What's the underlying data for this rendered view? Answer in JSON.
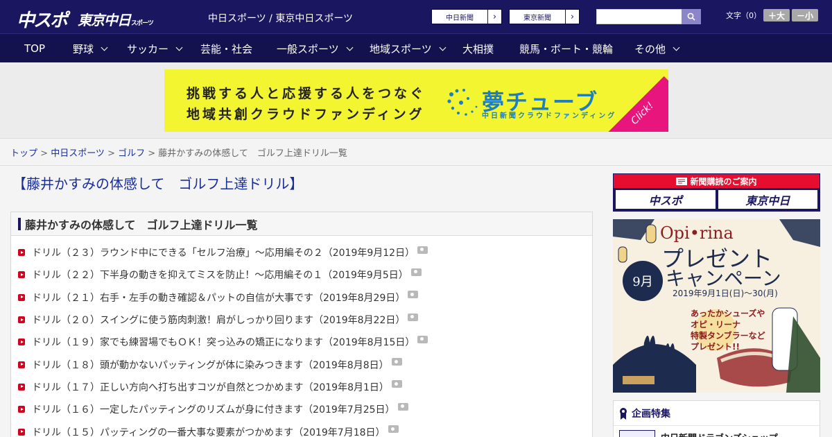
{
  "header": {
    "logo_chuspo": "中スポ",
    "logo_tokyo": "東京中日",
    "logo_tokyo_sub": "スポーツ",
    "site_links": "中日スポーツ / 東京中日スポーツ",
    "paper_buttons": [
      "中日新聞",
      "東京新聞"
    ],
    "search_placeholder": "",
    "fontsize_label": "文字（0）",
    "font_larger": "＋大",
    "font_smaller": "－小"
  },
  "nav": {
    "items": [
      {
        "label": "TOP",
        "dropdown": false
      },
      {
        "label": "野球",
        "dropdown": true
      },
      {
        "label": "サッカー",
        "dropdown": true
      },
      {
        "label": "芸能・社会",
        "dropdown": false
      },
      {
        "label": "一般スポーツ",
        "dropdown": true
      },
      {
        "label": "地域スポーツ",
        "dropdown": true
      },
      {
        "label": "大相撲",
        "dropdown": false
      },
      {
        "label": "競馬・ボート・競輪",
        "dropdown": false
      },
      {
        "label": "その他",
        "dropdown": true
      }
    ]
  },
  "banner": {
    "line1": "挑戦する人と応援する人をつなぐ",
    "line2": "地域共創クラウドファンディング",
    "brand": "夢チューブ",
    "brand_sub": "中日新聞クラウドファンディング",
    "click": "Click!"
  },
  "breadcrumb": {
    "items": [
      "トップ",
      "中日スポーツ",
      "ゴルフ"
    ],
    "current": "藤井かすみの体感して　ゴルフ上達ドリル一覧",
    "sep": " > "
  },
  "main": {
    "title": "【藤井かすみの体感して　ゴルフ上達ドリル】",
    "list_header": "藤井かすみの体感して　ゴルフ上達ドリル一覧",
    "articles": [
      "ドリル（２３）ラウンド中にできる「セルフ治療」～応用編その２（2019年9月12日）",
      "ドリル（２２）下半身の動きを抑えてミスを防止！～応用編その１（2019年9月5日）",
      "ドリル（２１）右手・左手の動き確認＆パットの自信が大事です（2019年8月29日）",
      "ドリル（２０）スイングに使う筋肉刺激！肩がしっかり回ります（2019年8月22日）",
      "ドリル（１９）家でも練習場でもＯＫ！突っ込みの矯正になります（2019年8月15日）",
      "ドリル（１８）頭が動かないパッティングが体に染みつきます（2019年8月8日）",
      "ドリル（１７）正しい方向へ打ち出すコツが自然とつかめます（2019年8月1日）",
      "ドリル（１６）一定したパッティングのリズムが身に付きます（2019年7月25日）",
      "ドリル（１５）パッティングの一番大事な要素がつかめます（2019年7月18日）"
    ]
  },
  "sidebar": {
    "subscribe_head": "新聞購読のご案内",
    "subscribe_logos": [
      "中スポ",
      "東京中日"
    ],
    "campaign": {
      "brand": "Opi•rina",
      "title1": "プレゼント",
      "title2": "キャンペーン",
      "date": "2019年9月1日(日)～30(月)",
      "month": "9月",
      "note1": "あったかシューズや",
      "note2": "オピ・リーナ",
      "note3": "特製タンブラーなど",
      "note4": "プレゼント!!"
    },
    "special_head": "企画特集",
    "special_item": "中日新聞ドラゴンズショップ"
  },
  "colors": {
    "header_bg": "#1a1660",
    "nav_bg": "#14124e",
    "link": "#1a2f9c",
    "marker": "#d6001c",
    "banner_bg": "#f4f531"
  }
}
